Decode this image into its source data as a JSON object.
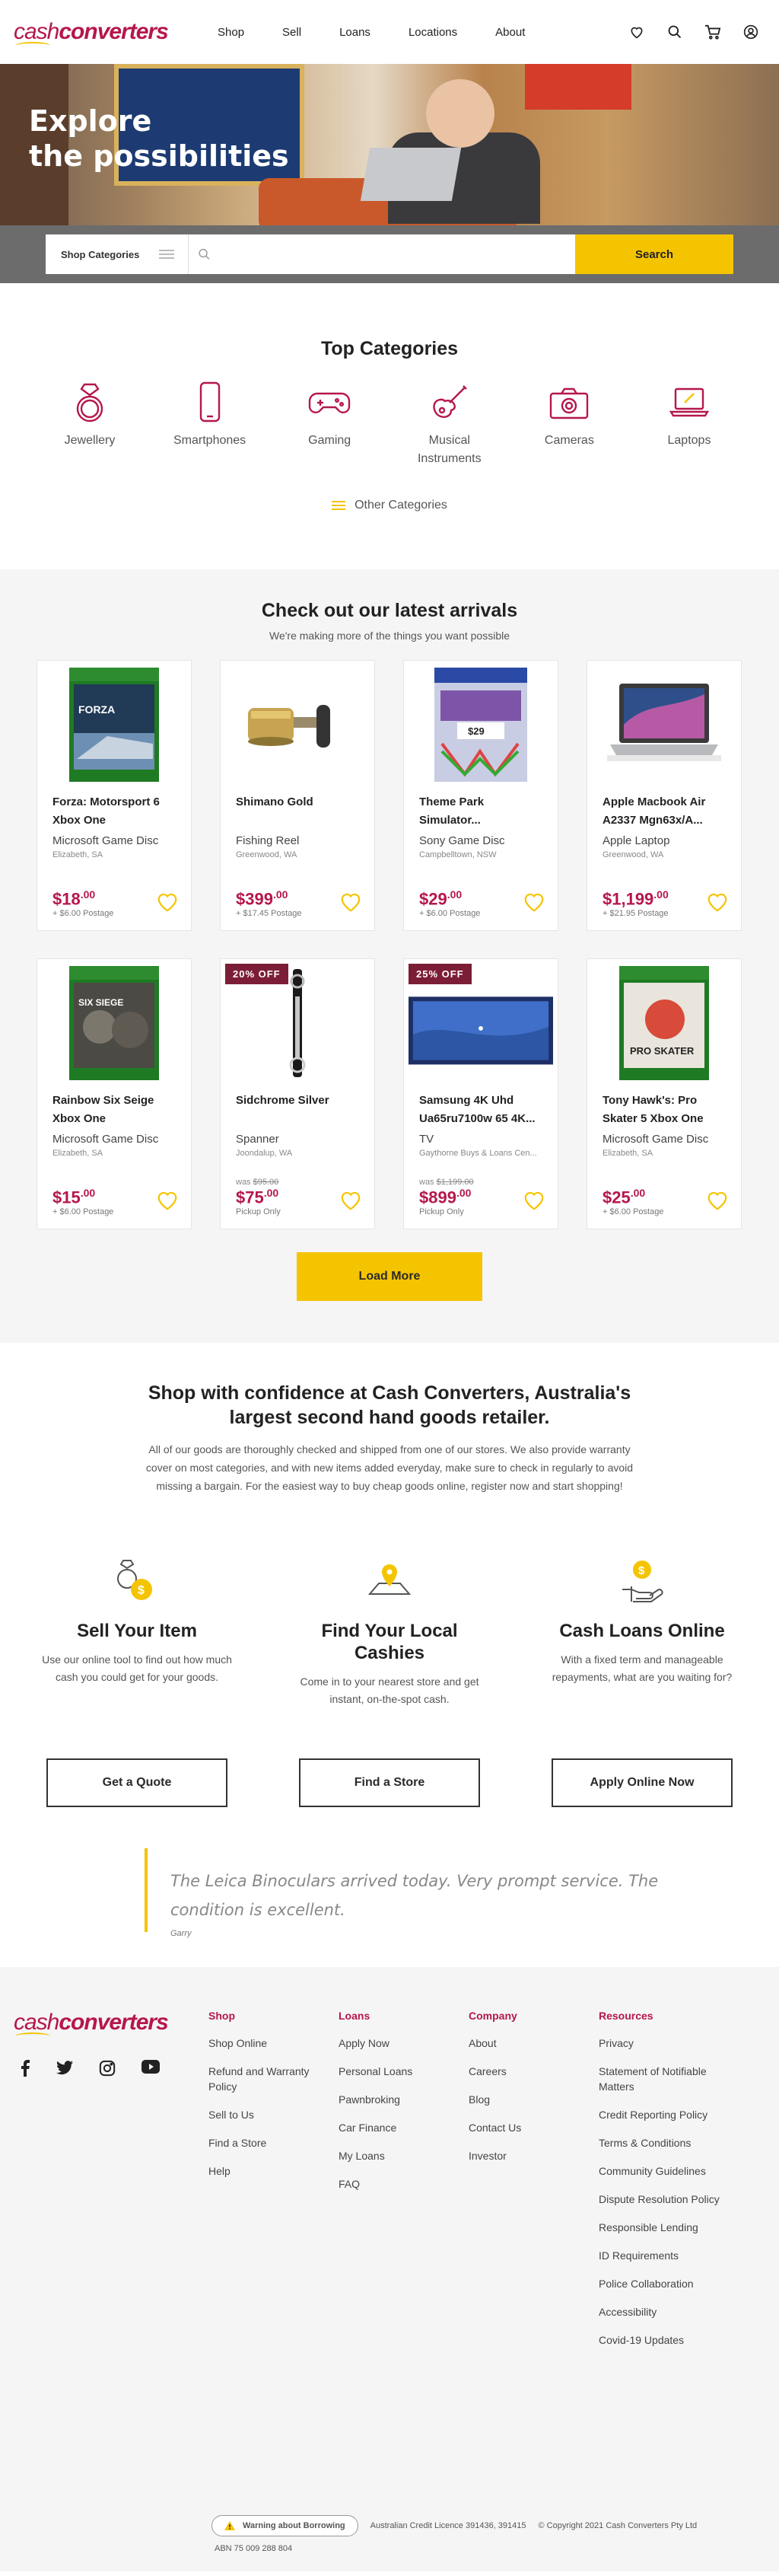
{
  "brand": {
    "part1": "cash",
    "part2": "converters"
  },
  "nav": [
    "Shop",
    "Sell",
    "Loans",
    "Locations",
    "About"
  ],
  "hero": {
    "line1": "Explore",
    "line2": "the possibilities"
  },
  "search": {
    "category": "Shop Categories",
    "placeholder": "",
    "button": "Search"
  },
  "top_categories": {
    "title": "Top Categories",
    "items": [
      "Jewellery",
      "Smartphones",
      "Gaming",
      "Musical Instruments",
      "Cameras",
      "Laptops"
    ],
    "other": "Other Categories"
  },
  "arrivals": {
    "title": "Check out our latest arrivals",
    "subtitle": "We're making more of the things you want possible",
    "products": [
      {
        "title": "Forza: Motorsport 6 Xbox One",
        "subtitle": "Microsoft Game Disc",
        "location": "Elizabeth, SA",
        "was": "",
        "price": "$18",
        "cents": ".00",
        "postage": "+ $6.00 Postage",
        "badge": ""
      },
      {
        "title": "Shimano Gold",
        "subtitle": "Fishing Reel",
        "location": "Greenwood, WA",
        "was": "",
        "price": "$399",
        "cents": ".00",
        "postage": "+ $17.45 Postage",
        "badge": ""
      },
      {
        "title": "Theme Park Simulator...",
        "subtitle": "Sony Game Disc",
        "location": "Campbelltown, NSW",
        "was": "",
        "price": "$29",
        "cents": ".00",
        "postage": "+ $6.00 Postage",
        "badge": ""
      },
      {
        "title": "Apple Macbook Air A2337 Mgn63x/A...",
        "subtitle": "Apple Laptop",
        "location": "Greenwood, WA",
        "was": "",
        "price": "$1,199",
        "cents": ".00",
        "postage": "+ $21.95 Postage",
        "badge": ""
      },
      {
        "title": "Rainbow Six Seige Xbox One",
        "subtitle": "Microsoft Game Disc",
        "location": "Elizabeth, SA",
        "was": "",
        "price": "$15",
        "cents": ".00",
        "postage": "+ $6.00 Postage",
        "badge": ""
      },
      {
        "title": "Sidchrome Silver",
        "subtitle": "Spanner",
        "location": "Joondalup, WA",
        "was_label": "was",
        "was": "$95.00",
        "price": "$75",
        "cents": ".00",
        "postage": "Pickup Only",
        "badge": "20% OFF"
      },
      {
        "title": "Samsung 4K Uhd Ua65ru7100w 65 4K...",
        "subtitle": "TV",
        "location": "Gaythorne Buys & Loans Cen...",
        "was_label": "was",
        "was": "$1,199.00",
        "price": "$899",
        "cents": ".00",
        "postage": "Pickup Only",
        "badge": "25% OFF"
      },
      {
        "title": "Tony Hawk's: Pro Skater 5 Xbox One",
        "subtitle": "Microsoft Game Disc",
        "location": "Elizabeth, SA",
        "was": "",
        "price": "$25",
        "cents": ".00",
        "postage": "+ $6.00 Postage",
        "badge": ""
      }
    ],
    "load_more": "Load More"
  },
  "confidence": {
    "title": "Shop with confidence at Cash Converters, Australia's largest second hand goods retailer.",
    "body": "All of our goods are thoroughly checked and shipped from one of our stores. We also provide warranty cover on most categories, and with new items added everyday, make sure to check in regularly to avoid missing a bargain. For the easiest way to buy cheap goods online, register now and start shopping!"
  },
  "services": [
    {
      "title": "Sell Your Item",
      "body": "Use our online tool to find out how much cash you could get for your goods.",
      "button": "Get a Quote",
      "icon": "ring-dollar-icon"
    },
    {
      "title": "Find Your Local Cashies",
      "body": "Come in to your nearest store and get instant, on-the-spot cash.",
      "button": "Find a Store",
      "icon": "map-pin-icon"
    },
    {
      "title": "Cash Loans Online",
      "body": "With a fixed term and manageable repayments, what are you waiting for?",
      "button": "Apply Online Now",
      "icon": "hand-coin-icon"
    }
  ],
  "testimonial": {
    "quote": "The Leica Binoculars arrived today. Very prompt service. The condition is excellent.",
    "author": "Garry"
  },
  "footer": {
    "columns": [
      {
        "title": "Shop",
        "links": [
          "Shop Online",
          "Refund and Warranty Policy",
          "Sell to Us",
          "Find a Store",
          "Help"
        ]
      },
      {
        "title": "Loans",
        "links": [
          "Apply Now",
          "Personal Loans",
          "Pawnbroking",
          "Car Finance",
          "My Loans",
          "FAQ"
        ]
      },
      {
        "title": "Company",
        "links": [
          "About",
          "Careers",
          "Blog",
          "Contact Us",
          "Investor"
        ]
      },
      {
        "title": "Resources",
        "links": [
          "Privacy",
          "Statement of Notifiable Matters",
          "Credit Reporting Policy",
          "Terms & Conditions",
          "Community Guidelines",
          "Dispute Resolution Policy",
          "Responsible Lending",
          "ID Requirements",
          "Police Collaboration",
          "Accessibility",
          "Covid-19 Updates"
        ]
      }
    ],
    "warning": "Warning about Borrowing",
    "licence": "Australian Credit Licence 391436, 391415",
    "copyright": "© Copyright 2021 Cash Converters Pty Ltd",
    "abn": "ABN 75 009 288 804"
  },
  "colors": {
    "brand": "#b5174b",
    "accent": "#f5c400",
    "badge": "#7c1d36"
  }
}
